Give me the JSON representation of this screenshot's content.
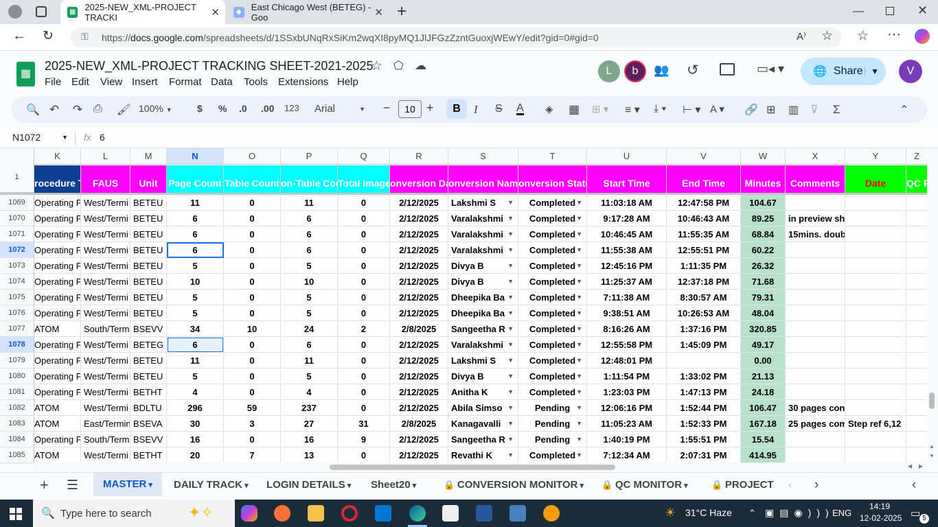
{
  "browser": {
    "tabs": [
      {
        "title": "2025-NEW_XML-PROJECT TRACKI",
        "active": true
      },
      {
        "title": "East Chicago West (BETEG) - Goo",
        "active": false
      }
    ],
    "url_prefix": "https://",
    "url_domain": "docs.google.com",
    "url_rest": "/spreadsheets/d/1SSxbUNqRxSiKm2wqXI8pyMQ1JlJFGzZzntGuoxjWEwY/edit?gid=0#gid=0"
  },
  "sheets": {
    "doc_title": "2025-NEW_XML-PROJECT TRACKING SHEET-2021-2025",
    "menu": [
      "File",
      "Edit",
      "View",
      "Insert",
      "Format",
      "Data",
      "Tools",
      "Extensions",
      "Help"
    ],
    "avatars": [
      "L",
      "b",
      "V"
    ],
    "share_label": "Share",
    "toolbar": {
      "zoom": "100%",
      "currency": "$",
      "percent": "%",
      "dec_dec": ".0",
      "dec_inc": ".00",
      "fmt123": "123",
      "font": "Arial",
      "font_size": "10"
    },
    "name_box": "N1072",
    "formula_fx": "fx",
    "formula_value": "6"
  },
  "grid": {
    "columns": [
      {
        "id": "K",
        "w": 68
      },
      {
        "id": "L",
        "w": 72
      },
      {
        "id": "M",
        "w": 53
      },
      {
        "id": "N",
        "w": 83
      },
      {
        "id": "O",
        "w": 83
      },
      {
        "id": "P",
        "w": 83
      },
      {
        "id": "Q",
        "w": 76
      },
      {
        "id": "R",
        "w": 85
      },
      {
        "id": "S",
        "w": 102
      },
      {
        "id": "T",
        "w": 100
      },
      {
        "id": "U",
        "w": 116
      },
      {
        "id": "V",
        "w": 108
      },
      {
        "id": "W",
        "w": 65
      },
      {
        "id": "X",
        "w": 87
      },
      {
        "id": "Y",
        "w": 89
      },
      {
        "id": "Z",
        "w": 31
      }
    ],
    "selected_column": "N",
    "header_row_num": "1",
    "headers": [
      "rocedure T",
      "FAUS",
      "Unit",
      "Page Count",
      "Table Count",
      "on-Table Cou",
      "Total Images",
      "onversion Da",
      "onversion Nam",
      "onversion Statu",
      "Start Time",
      "End Time",
      "Minutes",
      "Comments",
      "Date",
      "QC R"
    ],
    "header_colors": [
      "#0b3d91",
      "#ff00ff",
      "#ff00ff",
      "#00ffff",
      "#00ffff",
      "#00ffff",
      "#00ffff",
      "#ff00ff",
      "#ff00ff",
      "#ff00ff",
      "#ff00ff",
      "#ff00ff",
      "#ff00ff",
      "#ff00ff",
      "#00ff00",
      "#00ff00"
    ],
    "header_text_colors": [
      "#ffffff",
      "#ffffff",
      "#ffffff",
      "#ffffff",
      "#ffffff",
      "#ffffff",
      "#ffffff",
      "#ffffff",
      "#ffffff",
      "#ffffff",
      "#ffffff",
      "#ffffff",
      "#ffffff",
      "#ffffff",
      "#ff0000",
      "#ffffff"
    ],
    "rows": [
      {
        "n": "1069",
        "c": [
          "Operating Pr",
          "West/Termi",
          "BETEU",
          "11",
          "0",
          "11",
          "0",
          "2/12/2025",
          "Lakshmi S",
          "Completed",
          "11:03:18 AM",
          "12:47:58 PM",
          "104.67",
          "",
          ""
        ]
      },
      {
        "n": "1070",
        "c": [
          "Operating Pr",
          "West/Termi",
          "BETEU",
          "6",
          "0",
          "6",
          "0",
          "2/12/2025",
          "Varalakshmi",
          "Completed",
          "9:17:28 AM",
          "10:46:43 AM",
          "89.25",
          "in preview sh",
          ""
        ]
      },
      {
        "n": "1071",
        "c": [
          "Operating Pr",
          "West/Termi",
          "BETEU",
          "6",
          "0",
          "6",
          "0",
          "2/12/2025",
          "Varalakshmi",
          "Completed",
          "10:46:45 AM",
          "11:55:35 AM",
          "68.84",
          "15mins. doub",
          ""
        ]
      },
      {
        "n": "1072",
        "c": [
          "Operating Pr",
          "West/Termi",
          "BETEU",
          "6",
          "0",
          "6",
          "0",
          "2/12/2025",
          "Varalakshmi",
          "Completed",
          "11:55:38 AM",
          "12:55:51 PM",
          "60.22",
          "",
          ""
        ]
      },
      {
        "n": "1073",
        "c": [
          "Operating Pr",
          "West/Termi",
          "BETEU",
          "5",
          "0",
          "5",
          "0",
          "2/12/2025",
          "Divya B",
          "Completed",
          "12:45:16 PM",
          "1:11:35 PM",
          "26.32",
          "",
          ""
        ]
      },
      {
        "n": "1074",
        "c": [
          "Operating Pr",
          "West/Termi",
          "BETEU",
          "10",
          "0",
          "10",
          "0",
          "2/12/2025",
          "Divya B",
          "Completed",
          "11:25:37 AM",
          "12:37:18 PM",
          "71.68",
          "",
          ""
        ]
      },
      {
        "n": "1075",
        "c": [
          "Operating Pr",
          "West/Termi",
          "BETEU",
          "5",
          "0",
          "5",
          "0",
          "2/12/2025",
          "Dheepika Ba",
          "Completed",
          "7:11:38 AM",
          "8:30:57 AM",
          "79.31",
          "",
          ""
        ]
      },
      {
        "n": "1076",
        "c": [
          "Operating Pr",
          "West/Termi",
          "BETEU",
          "5",
          "0",
          "5",
          "0",
          "2/12/2025",
          "Dheepika Ba",
          "Completed",
          "9:38:51 AM",
          "10:26:53 AM",
          "48.04",
          "",
          ""
        ]
      },
      {
        "n": "1077",
        "c": [
          "ATOM",
          "South/Term",
          "BSEVV",
          "34",
          "10",
          "24",
          "2",
          "2/8/2025",
          "Sangeetha R",
          "Completed",
          "8:16:26 AM",
          "1:37:16 PM",
          "320.85",
          "",
          ""
        ]
      },
      {
        "n": "1078",
        "c": [
          "Operating Pr",
          "West/Termi",
          "BETEG",
          "6",
          "0",
          "6",
          "0",
          "2/12/2025",
          "Varalakshmi",
          "Completed",
          "12:55:58 PM",
          "1:45:09 PM",
          "49.17",
          "",
          ""
        ]
      },
      {
        "n": "1079",
        "c": [
          "Operating Pr",
          "West/Termi",
          "BETEU",
          "11",
          "0",
          "11",
          "0",
          "2/12/2025",
          "Lakshmi S",
          "Completed",
          "12:48:01 PM",
          "",
          "0.00",
          "",
          ""
        ]
      },
      {
        "n": "1080",
        "c": [
          "Operating Pr",
          "West/Termi",
          "BETEU",
          "5",
          "0",
          "5",
          "0",
          "2/12/2025",
          "Divya B",
          "Completed",
          "1:11:54 PM",
          "1:33:02 PM",
          "21.13",
          "",
          ""
        ]
      },
      {
        "n": "1081",
        "c": [
          "Operating Pr",
          "West/Termi",
          "BETHT",
          "4",
          "0",
          "4",
          "0",
          "2/12/2025",
          "Anitha K",
          "Completed",
          "1:23:03 PM",
          "1:47:13 PM",
          "24.18",
          "",
          ""
        ]
      },
      {
        "n": "1082",
        "c": [
          "ATOM",
          "West/Termi",
          "BDLTU",
          "296",
          "59",
          "237",
          "0",
          "2/12/2025",
          "Abila Simso",
          "Pending",
          "12:06:16 PM",
          "1:52:44 PM",
          "106.47",
          "30 pages con",
          ""
        ]
      },
      {
        "n": "1083",
        "c": [
          "ATOM",
          "East/Termin",
          "BSEVA",
          "30",
          "3",
          "27",
          "31",
          "2/8/2025",
          "Kanagavalli",
          "Pending",
          "11:05:23 AM",
          "1:52:33 PM",
          "167.18",
          "25 pages com",
          "Step ref 6,12"
        ]
      },
      {
        "n": "1084",
        "c": [
          "Operating Pr",
          "South/Term",
          "BSEVV",
          "16",
          "0",
          "16",
          "9",
          "2/12/2025",
          "Sangeetha R",
          "Pending",
          "1:40:19 PM",
          "1:55:51 PM",
          "15.54",
          "",
          ""
        ]
      },
      {
        "n": "1085",
        "c": [
          "ATOM",
          "West/Termi",
          "BETHT",
          "20",
          "7",
          "13",
          "0",
          "2/12/2025",
          "Revathi K",
          "Completed",
          "7:12:34 AM",
          "2:07:31 PM",
          "414.95",
          "",
          ""
        ]
      }
    ]
  },
  "sheet_tabs": [
    {
      "label": "MASTER",
      "active": true,
      "lock": false
    },
    {
      "label": "DAILY TRACK",
      "active": false,
      "lock": false
    },
    {
      "label": "LOGIN DETAILS",
      "active": false,
      "lock": false
    },
    {
      "label": "Sheet20",
      "active": false,
      "lock": false
    },
    {
      "label": "CONVERSION MONITOR",
      "active": false,
      "lock": true
    },
    {
      "label": "QC MONITOR",
      "active": false,
      "lock": true
    },
    {
      "label": "PROJECT S",
      "active": false,
      "lock": true
    }
  ],
  "taskbar": {
    "search_placeholder": "Type here to search",
    "weather": "31°C  Haze",
    "lang": "ENG",
    "time": "14:19",
    "date": "12-02-2025",
    "notif_count": "5"
  }
}
